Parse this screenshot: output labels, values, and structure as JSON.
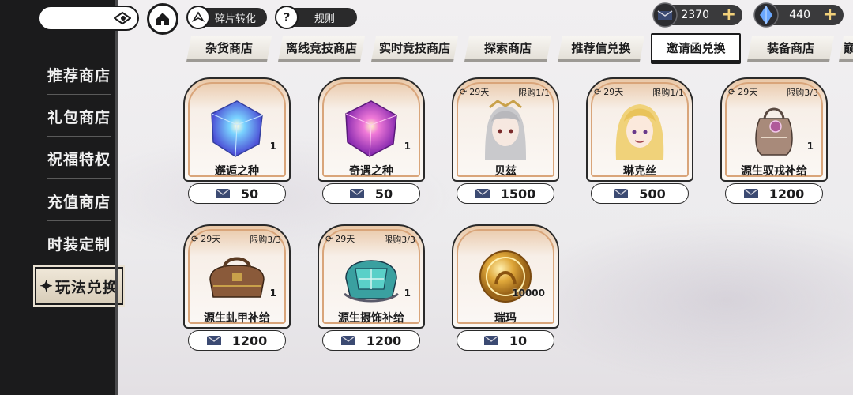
{
  "topbar": {
    "fragment_label": "碎片转化",
    "rules_label": "规则",
    "rules_icon": "?",
    "currency1": {
      "value": "2370",
      "plus": "+"
    },
    "currency2": {
      "value": "440",
      "plus": "+"
    }
  },
  "sidebar": {
    "items": [
      {
        "label": "推荐商店"
      },
      {
        "label": "礼包商店"
      },
      {
        "label": "祝福特权"
      },
      {
        "label": "充值商店"
      },
      {
        "label": "时装定制"
      },
      {
        "label": "玩法兑换",
        "star": "✦"
      }
    ]
  },
  "tabs": [
    {
      "label": "杂货商店"
    },
    {
      "label": "离线竞技商店"
    },
    {
      "label": "实时竞技商店"
    },
    {
      "label": "探索商店"
    },
    {
      "label": "推荐信兑换"
    },
    {
      "label": "邀请函兑换"
    },
    {
      "label": "装备商店"
    },
    {
      "label": "巅"
    }
  ],
  "items": [
    {
      "name": "邂逅之种",
      "qty": "1",
      "price": "50",
      "timer": "",
      "limit": ""
    },
    {
      "name": "奇遇之种",
      "qty": "1",
      "price": "50",
      "timer": "",
      "limit": ""
    },
    {
      "name": "贝兹",
      "qty": "",
      "price": "1500",
      "timer": "29天",
      "limit": "限购1/1"
    },
    {
      "name": "琳克丝",
      "qty": "",
      "price": "500",
      "timer": "29天",
      "limit": "限购1/1"
    },
    {
      "name": "源生驭戎补给",
      "qty": "1",
      "price": "1200",
      "timer": "29天",
      "limit": "限购3/3"
    },
    {
      "name": "源生虬甲补给",
      "qty": "1",
      "price": "1200",
      "timer": "29天",
      "limit": "限购3/3"
    },
    {
      "name": "源生摄饰补给",
      "qty": "1",
      "price": "1200",
      "timer": "29天",
      "limit": "限购3/3"
    },
    {
      "name": "瑞玛",
      "qty": "10000",
      "price": "10",
      "timer": "",
      "limit": ""
    }
  ],
  "colors": {
    "accent": "#f1d07a",
    "frame": "#d9a57a",
    "dark": "#1b1b1c"
  }
}
